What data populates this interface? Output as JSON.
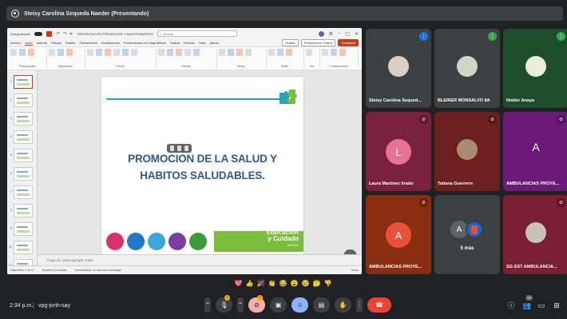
{
  "meet": {
    "presenter_bar": "Steisy Carolina Sequeda Naeder (Presentando)",
    "time": "2:34 p.m.",
    "separator": "|",
    "meeting_code": "vpg-jonh-say",
    "people_count": "16"
  },
  "ppt": {
    "title_bar": {
      "autosave_label": "Autoguardado",
      "doc_title": "PRESENTACIÓN PROMOCIÓN Y MANTENIMIENTO - Guardado en este PC",
      "search_placeholder": "Buscar"
    },
    "menu": [
      "Archivo",
      "Inicio",
      "Insertar",
      "Dibujar",
      "Diseño",
      "Transiciones",
      "Animaciones",
      "Presentación con diapositivas",
      "Grabar",
      "Revisar",
      "Vista",
      "Ayuda"
    ],
    "menu_right": {
      "grabar": "Grabar",
      "presentar": "Presentar en Teams",
      "compartir": "Compartir"
    },
    "ribbon_groups": [
      "Portapapeles",
      "Diapositivas",
      "Fuente",
      "Párrafo",
      "Dibujo",
      "Editar",
      "Voz",
      "Complementos"
    ],
    "slide": {
      "title_line1": "PROMOCION DE LA SALUD Y",
      "title_line2": "HABITOS SALUDABLES.",
      "footer_brand": "Educación",
      "footer_brand2": "y Cuidado",
      "footer_small": "SAN ES"
    },
    "slide_numbers": [
      "1",
      "2",
      "3",
      "4",
      "5",
      "6",
      "7",
      "8",
      "9",
      "10",
      "11",
      "12"
    ],
    "notes_placeholder": "Haga clic para agregar notas",
    "status_left": "Diapositiva 1 de 12",
    "status_lang": "Español (Colombia)",
    "status_access": "Accesibilidad: es necesario investigar",
    "status_right": "Notas",
    "colors": {
      "ppt_accent": "#c43e1c",
      "title_blue": "#2e5a8a",
      "green_band": "#7cbe3c"
    }
  },
  "tiles": [
    {
      "name": "Steisy Carolina Sequed...",
      "type": "photo",
      "bg": "#3c4043",
      "mic": "blue"
    },
    {
      "name": "BLEINER MONSALVO 8A",
      "type": "photo",
      "bg": "#3c4043",
      "mic": "green"
    },
    {
      "name": "Neider Anaya",
      "type": "photo",
      "bg": "#1e4d2b",
      "mic": "green"
    },
    {
      "name": "Laura Martínez tirado",
      "type": "letter",
      "letter": "L",
      "bg": "#7a2140",
      "mic": "muted"
    },
    {
      "name": "Tatiana Guerrero",
      "type": "photo",
      "bg": "#6d1f1f",
      "mic": "muted"
    },
    {
      "name": "AMBULANCIAS PROYE...",
      "type": "letter",
      "letter": "A",
      "bg": "#6a1b7a",
      "mic": "muted"
    },
    {
      "name": "AMBULANCIAS PROYE...",
      "type": "letter",
      "letter": "A",
      "bg": "#8a2e12",
      "mic": "muted"
    },
    {
      "name": "5 más",
      "type": "more",
      "letter": "A",
      "bg": "#3c4043",
      "mic": "none"
    },
    {
      "name": "SG-SST AMBULANCIA...",
      "type": "photo",
      "bg": "#7a1f33",
      "mic": "muted"
    }
  ],
  "reactions": [
    "💖",
    "👍",
    "🎉",
    "👏",
    "😂",
    "😮",
    "😢",
    "🤔",
    "👎"
  ],
  "controls": [
    "more",
    "microphone",
    "camera",
    "present",
    "emoji",
    "captions",
    "raise-hand",
    "more-options",
    "leave-call"
  ],
  "badges": {
    "mic_badge": "!",
    "cam_badge": "!"
  }
}
